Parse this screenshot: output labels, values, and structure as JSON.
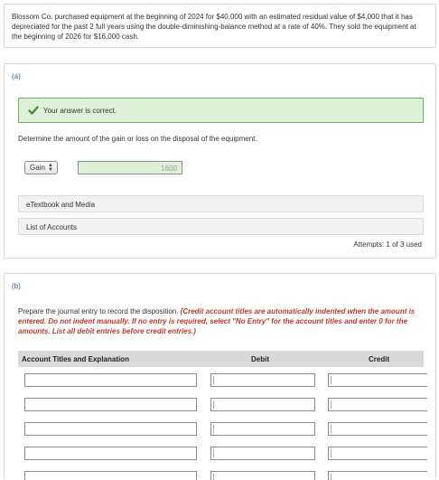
{
  "problem": {
    "text": "Blossom Co. purchased equipment at the beginning of 2024 for $40,000 with an estimated residual value of $4,000 that it has depreciated for the past 2 full years using the double-diminishing-balance method at a rate of 40%. They sold the equipment at the beginning of 2026 for $16,000 cash."
  },
  "part_a": {
    "label": "(a)",
    "feedback": "Your answer is correct.",
    "question": "Determine the amount of the gain or loss on the disposal of the equipment.",
    "select_value": "Gain",
    "answer_value": "1600",
    "etextbook_label": "eTextbook and Media",
    "accounts_label": "List of Accounts",
    "attempts": "Attempts: 1 of 3 used"
  },
  "part_b": {
    "label": "(b)",
    "question_plain": "Prepare the journal entry to record the disposition. ",
    "question_instructions": "(Credit account titles are automatically indented when the amount is entered. Do not indent manually. If no entry is required, select \"No Entry\" for the account titles and enter 0 for the amounts. List all debit entries before credit entries.)",
    "columns": {
      "account": "Account Titles and Explanation",
      "debit": "Debit",
      "credit": "Credit"
    }
  },
  "colors": {
    "success_bg": "#dff0d8",
    "success_border": "#6cb34f",
    "instruction_red": "#c0392b",
    "part_label_blue": "#2a6db0"
  }
}
